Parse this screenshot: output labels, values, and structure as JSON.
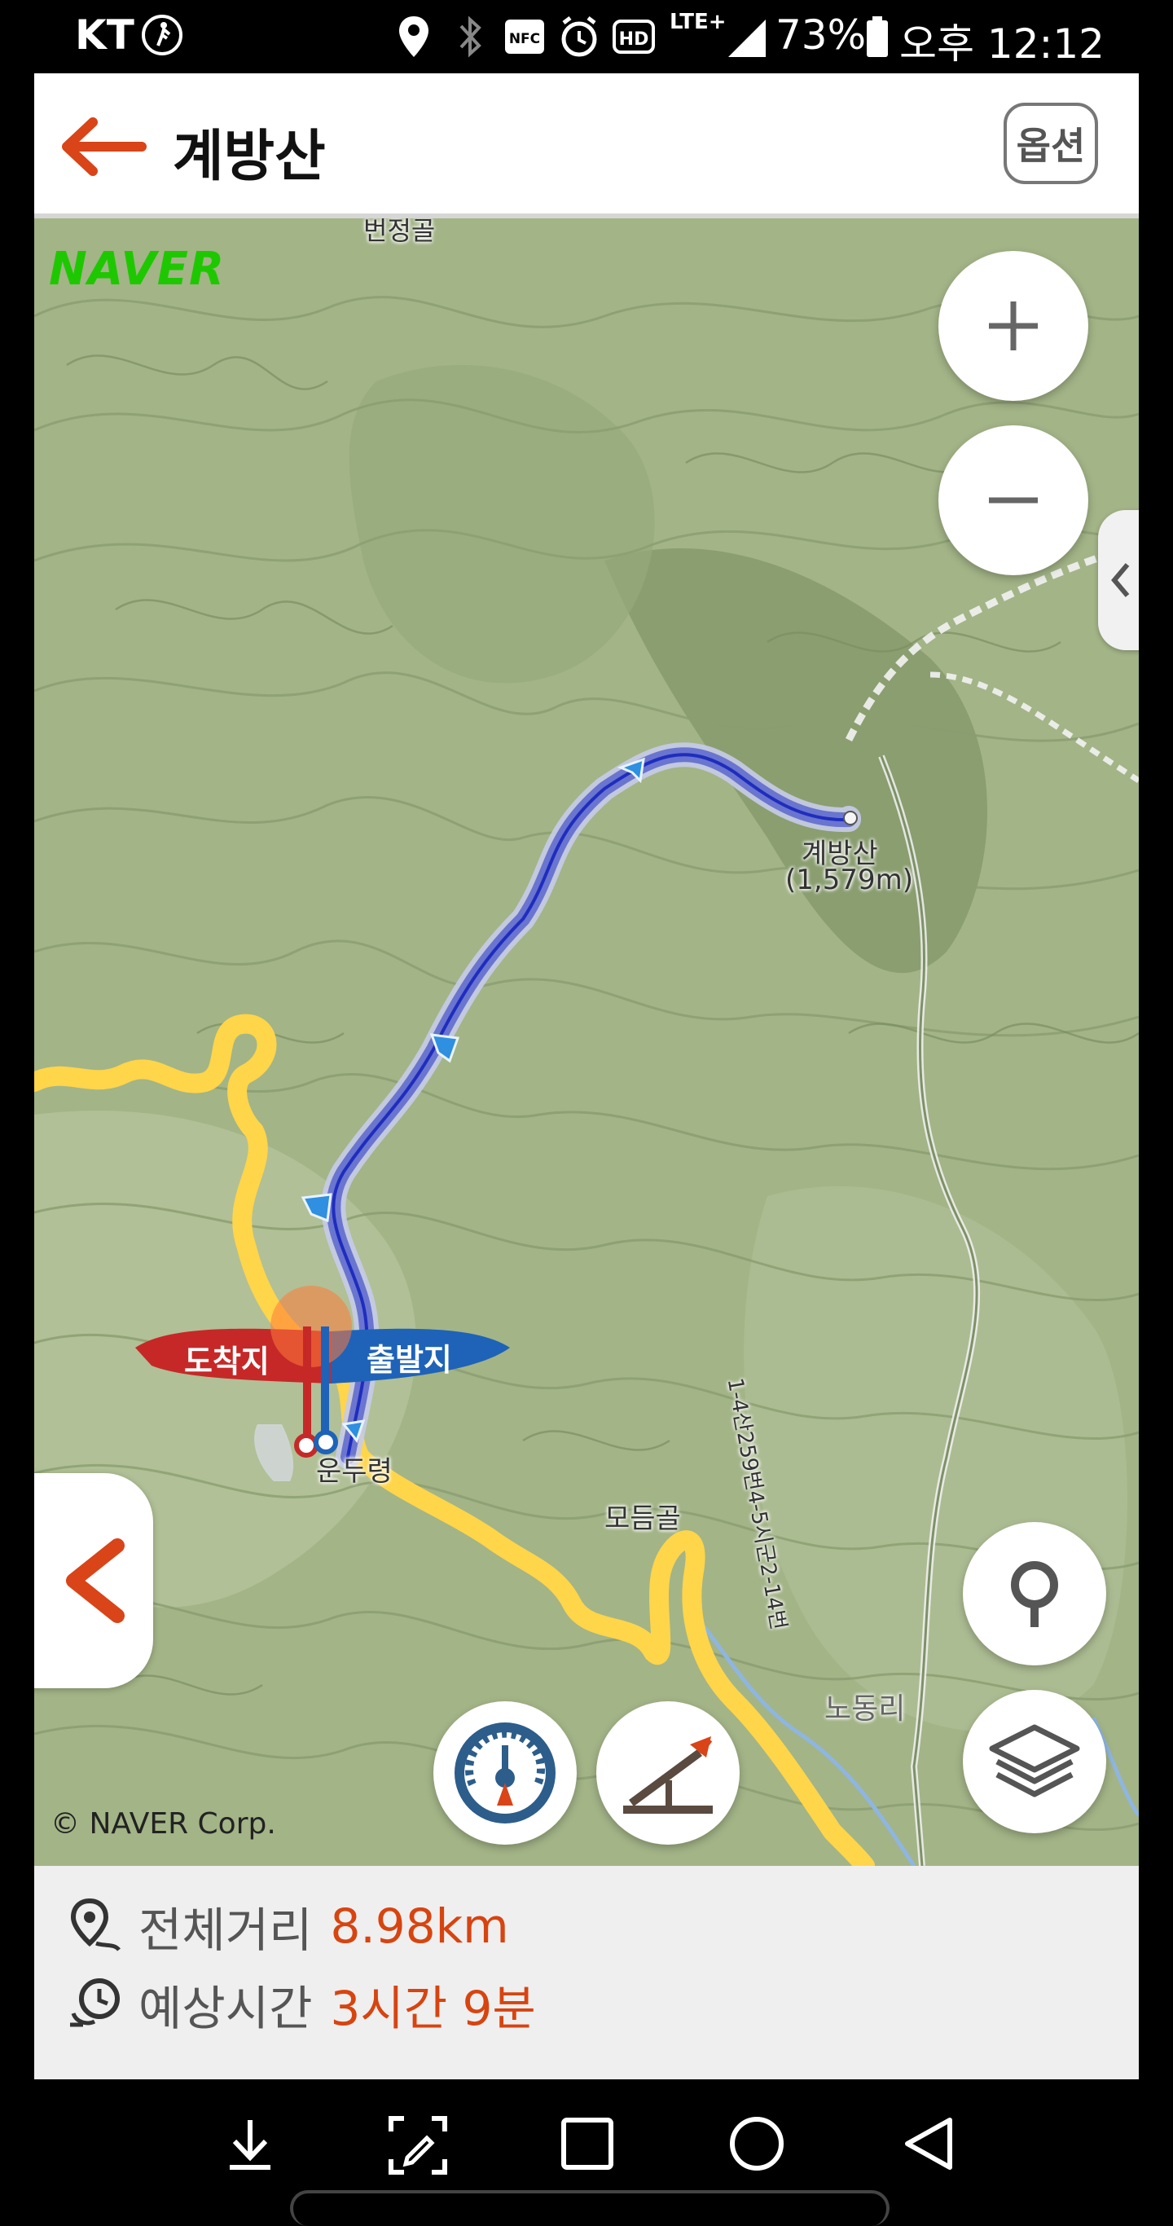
{
  "status_bar": {
    "carrier": "KT",
    "battery": "73%",
    "time": "오후 12:12",
    "network": "LTE+",
    "icons": [
      "walk-icon",
      "location-icon",
      "bluetooth-icon",
      "nfc-icon",
      "alarm-icon",
      "hd-icon",
      "lte-icon",
      "signal-icon",
      "battery-icon"
    ]
  },
  "header": {
    "title": "계방산",
    "option_label": "옵션",
    "accent": "#d94418"
  },
  "map": {
    "logo": "NAVER",
    "copyright": "© NAVER Corp.",
    "labels": {
      "top_cut": "번정골",
      "peak_name": "계방산",
      "peak_height": "(1,579m)",
      "pass": "운두령",
      "valley": "모듬골",
      "village": "노동리",
      "trail_road": "1-4산259번4-5시군2-14번"
    },
    "markers": {
      "arrival": "도착지",
      "departure": "출발지"
    },
    "colors": {
      "route": "#2233cc",
      "road": "#ffd54a",
      "arrival": "#c62828",
      "departure": "#1e63b8"
    }
  },
  "summary": {
    "distance_label": "전체거리",
    "distance_value": "8.98km",
    "time_label": "예상시간",
    "time_value": "3시간 9분"
  }
}
